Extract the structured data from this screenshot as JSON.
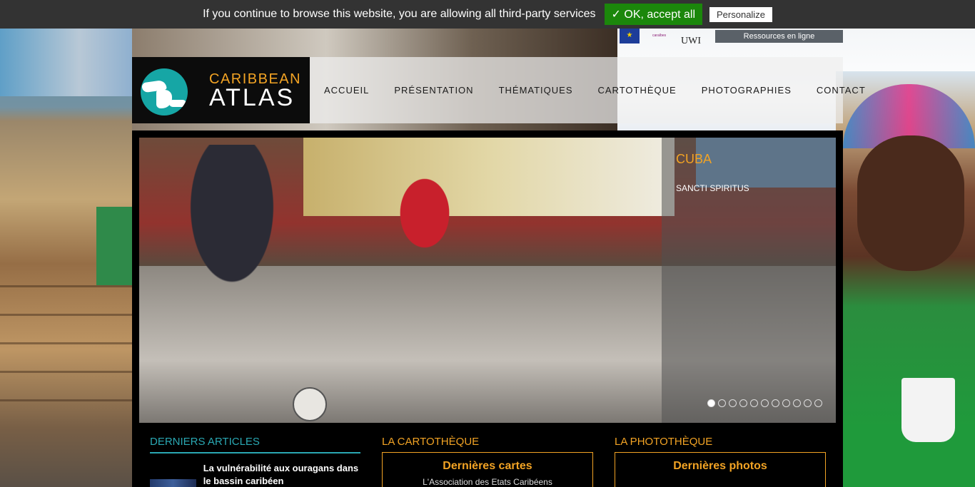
{
  "cookie_bar": {
    "message": "If you continue to browse this website, you are allowing all third-party services",
    "accept_label": "✓ OK, accept all",
    "personalize_label": "Personalize"
  },
  "partners": {
    "uwi_label": "UWI",
    "interreg_label": "caraïbes"
  },
  "resources_label": "Ressources en ligne",
  "logo": {
    "line1": "CARIBBEAN",
    "line2": "ATLAS"
  },
  "nav": [
    {
      "label": "Accueil"
    },
    {
      "label": "Présentation"
    },
    {
      "label": "Thématiques"
    },
    {
      "label": "Cartothèque"
    },
    {
      "label": "Photographies"
    },
    {
      "label": "Contact"
    }
  ],
  "slider": {
    "title": "CUBA",
    "subtitle": "SANCTI SPIRITUS",
    "slide_count": 11,
    "active_slide": 1
  },
  "columns": {
    "articles": {
      "title": "Derniers articles",
      "first_article_title": "La vulnérabilité aux ouragans dans le bassin caribéen"
    },
    "cartotheque": {
      "title": "La cartothèque",
      "box_title": "Dernières cartes",
      "box_text": "L'Association des Etats Caribéens"
    },
    "phototheque": {
      "title": "La photothèque",
      "box_title": "Dernières photos"
    }
  },
  "colors": {
    "accent_orange": "#f2a324",
    "accent_teal": "#2aa8b3",
    "cookie_green": "#1b870b"
  }
}
